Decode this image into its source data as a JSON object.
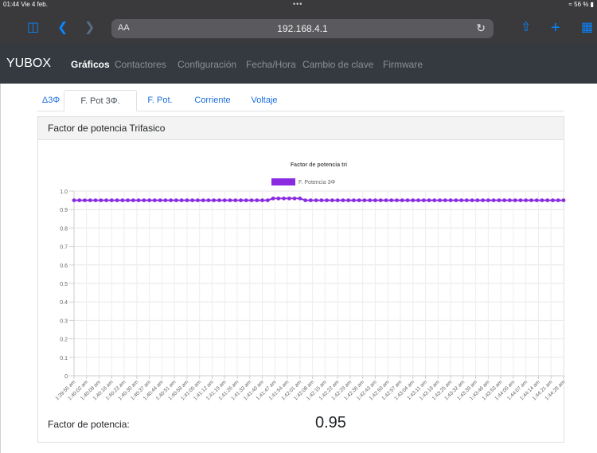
{
  "status": {
    "time": "01:44",
    "date": "Vie 4 feb.",
    "dots": "•••",
    "battery": "56 %"
  },
  "browser": {
    "text_size": "AA",
    "url": "192.168.4.1",
    "icons": [
      "sidebar-icon",
      "back-icon",
      "forward-icon",
      "reload-icon",
      "share-icon",
      "new-tab-icon",
      "tabs-icon"
    ]
  },
  "navbar": {
    "brand": "YUBOX",
    "items": [
      {
        "label": "Gráficos",
        "active": true
      },
      {
        "label": "Contactores"
      },
      {
        "label": "Configuración"
      },
      {
        "label": "Fecha/Hora"
      },
      {
        "label": "Cambio de clave"
      },
      {
        "label": "Firmware"
      }
    ]
  },
  "tabs": [
    {
      "label": "Δ3Φ"
    },
    {
      "label": "F. Pot 3Φ.",
      "active": true
    },
    {
      "label": "F. Pot."
    },
    {
      "label": "Corriente"
    },
    {
      "label": "Voltaje"
    }
  ],
  "card": {
    "title": "Factor de potencia Trifasico"
  },
  "chart_data": {
    "type": "line",
    "title": "Factor de potencia tri",
    "legend": "top",
    "series": [
      {
        "name": "F. Potencia 3Φ",
        "color": "#8a2be2",
        "values": [
          0.95,
          0.95,
          0.95,
          0.95,
          0.95,
          0.95,
          0.95,
          0.95,
          0.95,
          0.95,
          0.95,
          0.95,
          0.95,
          0.95,
          0.95,
          0.95,
          0.95,
          0.95,
          0.95,
          0.95,
          0.95,
          0.95,
          0.95,
          0.95,
          0.95,
          0.95,
          0.95,
          0.95,
          0.95,
          0.95,
          0.95,
          0.95,
          0.95,
          0.95,
          0.95,
          0.95,
          0.95,
          0.96,
          0.96,
          0.96,
          0.96,
          0.96,
          0.96,
          0.95,
          0.95,
          0.95,
          0.95,
          0.95,
          0.95,
          0.95,
          0.95,
          0.95,
          0.95,
          0.95,
          0.95,
          0.95,
          0.95,
          0.95,
          0.95,
          0.95,
          0.95,
          0.95,
          0.95,
          0.95,
          0.95,
          0.95,
          0.95,
          0.95,
          0.95,
          0.95,
          0.95,
          0.95,
          0.95,
          0.95,
          0.95,
          0.95,
          0.95,
          0.95,
          0.95,
          0.95,
          0.95,
          0.95,
          0.95,
          0.95,
          0.95,
          0.95,
          0.95,
          0.95,
          0.95,
          0.95,
          0.95,
          0.95
        ]
      }
    ],
    "xtick_labels": [
      "1:39:55 am",
      "1:40:02 am",
      "1:40:09 am",
      "1:40:16 am",
      "1:40:23 am",
      "1:40:30 am",
      "1:40:37 am",
      "1:40:44 am",
      "1:40:51 am",
      "1:40:58 am",
      "1:41:05 am",
      "1:41:12 am",
      "1:41:19 am",
      "1:41:26 am",
      "1:41:33 am",
      "1:41:40 am",
      "1:41:47 am",
      "1:41:54 am",
      "1:42:01 am",
      "1:42:08 am",
      "1:42:15 am",
      "1:42:22 am",
      "1:42:29 am",
      "1:42:36 am",
      "1:42:43 am",
      "1:42:50 am",
      "1:42:57 am",
      "1:43:04 am",
      "1:43:11 am",
      "1:43:18 am",
      "1:43:25 am",
      "1:43:32 am",
      "1:43:39 am",
      "1:43:46 am",
      "1:43:53 am",
      "1:44:00 am",
      "1:44:07 am",
      "1:44:14 am",
      "1:44:21 am",
      "1:44:28 am"
    ],
    "yticks": [
      0,
      0.1,
      0.2,
      0.3,
      0.4,
      0.5,
      0.6,
      0.7,
      0.8,
      0.9,
      1.0
    ],
    "ytick_labels": [
      "0",
      "0.1",
      "0.2",
      "0.3",
      "0.4",
      "0.5",
      "0.6",
      "0.7",
      "0.8",
      "0.9",
      "1.0"
    ],
    "ylim": [
      0,
      1.0
    ],
    "grid": true
  },
  "footer": {
    "label": "Factor de potencia:",
    "value": "0.95"
  }
}
